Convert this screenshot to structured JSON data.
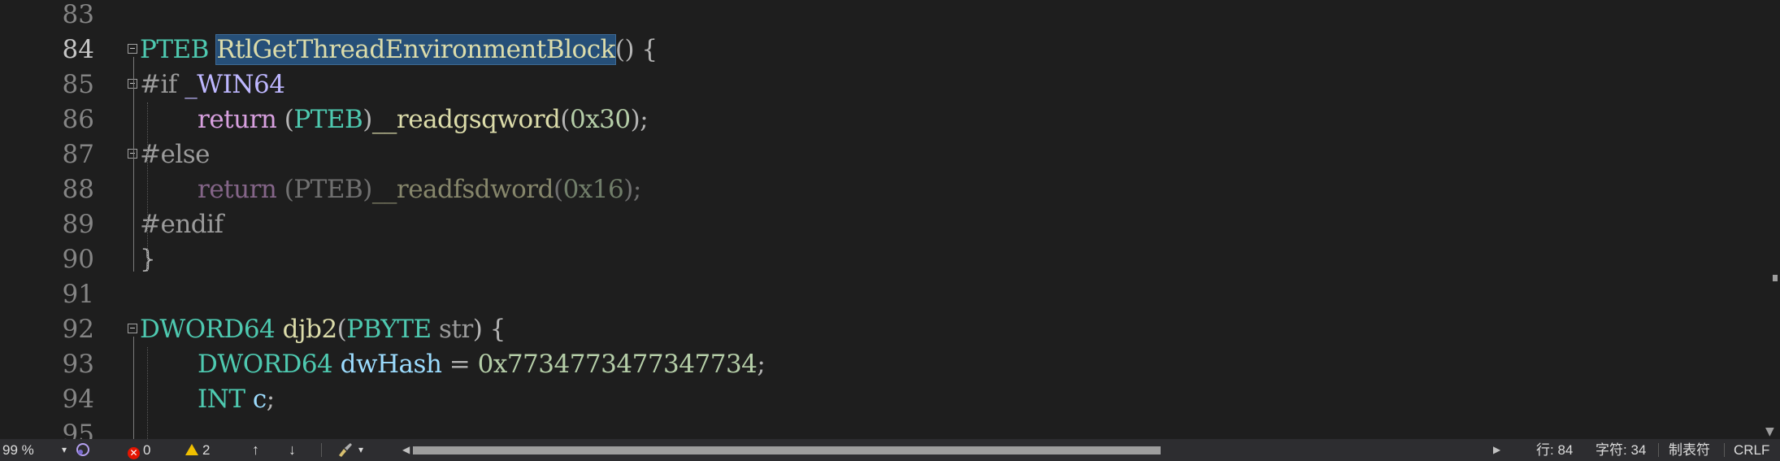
{
  "editor": {
    "lines": [
      {
        "num": "83"
      },
      {
        "num": "84"
      },
      {
        "num": "85"
      },
      {
        "num": "86"
      },
      {
        "num": "87"
      },
      {
        "num": "88"
      },
      {
        "num": "89"
      },
      {
        "num": "90"
      },
      {
        "num": "91"
      },
      {
        "num": "92"
      },
      {
        "num": "93"
      },
      {
        "num": "94"
      },
      {
        "num": "95"
      }
    ],
    "tokens": {
      "l84_type": "PTEB",
      "l84_func": "RtlGetThreadEnvironmentBlock",
      "l84_rest": "() {",
      "l85_pre": "#if",
      "l85_macro": "_WIN64",
      "l86_kw": "return",
      "l86_p1": "(",
      "l86_type": "PTEB",
      "l86_p2": ")",
      "l86_func": "__readgsqword",
      "l86_p3": "(",
      "l86_num": "0x30",
      "l86_p4": ");",
      "l87_pre": "#else",
      "l88_kw": "return",
      "l88_rest": "(PTEB)",
      "l88_func": "__readfsdword",
      "l88_p3": "(",
      "l88_num": "0x16",
      "l88_p4": ");",
      "l89_pre": "#endif",
      "l90_brace": "}",
      "l92_type": "DWORD64",
      "l92_func": "djb2",
      "l92_p1": "(",
      "l92_ptype": "PBYTE",
      "l92_param": "str",
      "l92_p2": ") {",
      "l93_type": "DWORD64",
      "l93_var": "dwHash",
      "l93_op": " = ",
      "l93_num": "0x7734773477347734",
      "l93_semi": ";",
      "l94_type": "INT",
      "l94_var": "c",
      "l94_semi": ";"
    }
  },
  "statusbar": {
    "zoom": "99 %",
    "errors": "0",
    "warnings": "2",
    "up_arrow": "↑",
    "down_arrow": "↓",
    "line_col_row": "行: 84",
    "line_col_char": "字符: 34",
    "indent": "制表符",
    "eol": "CRLF"
  },
  "colors": {
    "background": "#1e1e1e",
    "statusbar": "#2d2d30",
    "type": "#4ec9b0",
    "function": "#dcdcaa",
    "keyword": "#d8a0df",
    "number": "#b5cea8",
    "variable": "#9cdcfe",
    "highlight": "#264f78"
  },
  "icons": [
    "fold-collapse-icon",
    "error-icon",
    "warning-icon",
    "brush-icon",
    "chevron-down-icon",
    "scroll-left-icon",
    "scroll-right-icon"
  ]
}
